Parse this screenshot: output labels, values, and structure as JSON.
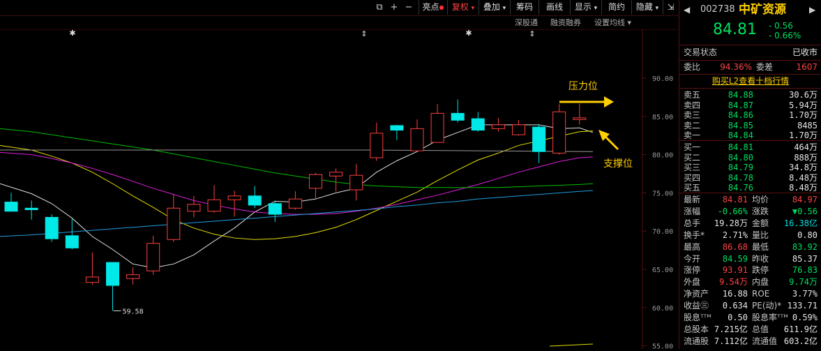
{
  "toolbar": {
    "buttons": [
      {
        "label": "亮点",
        "active": false
      },
      {
        "label": "复权",
        "active": true
      },
      {
        "label": "叠加",
        "active": false
      },
      {
        "label": "筹码",
        "active": false
      },
      {
        "label": "画线",
        "active": false
      },
      {
        "label": "显示",
        "active": false
      },
      {
        "label": "简约",
        "active": false
      },
      {
        "label": "隐藏",
        "active": false
      }
    ],
    "sub": [
      "深股通",
      "融资融券",
      "设置均线"
    ]
  },
  "chart_data": {
    "type": "candlestick",
    "y_ticks": [
      "90.00",
      "85.00",
      "80.00",
      "75.00",
      "70.00",
      "65.00",
      "60.00",
      "55.00"
    ],
    "ylim": [
      55,
      90
    ],
    "low_marker": "59.58",
    "annotations": [
      "压力位",
      "支撑位"
    ],
    "candles": [
      {
        "o": 73.8,
        "c": 72.6,
        "h": 75.0,
        "l": 72.6
      },
      {
        "o": 73.0,
        "c": 72.8,
        "h": 74.0,
        "l": 71.5
      },
      {
        "o": 71.8,
        "c": 69.0,
        "h": 72.2,
        "l": 68.6
      },
      {
        "o": 69.4,
        "c": 67.8,
        "h": 71.6,
        "l": 67.6
      },
      {
        "o": 63.3,
        "c": 64.0,
        "h": 67.2,
        "l": 63.0
      },
      {
        "o": 65.9,
        "c": 62.9,
        "h": 65.9,
        "l": 59.6
      },
      {
        "o": 63.8,
        "c": 64.3,
        "h": 65.3,
        "l": 63.0
      },
      {
        "o": 64.8,
        "c": 68.4,
        "h": 69.4,
        "l": 64.3
      },
      {
        "o": 68.9,
        "c": 73.0,
        "h": 74.8,
        "l": 68.6
      },
      {
        "o": 72.6,
        "c": 73.5,
        "h": 74.6,
        "l": 71.8
      },
      {
        "o": 72.6,
        "c": 74.1,
        "h": 76.0,
        "l": 72.4
      },
      {
        "o": 74.1,
        "c": 74.6,
        "h": 75.3,
        "l": 71.9
      },
      {
        "o": 74.6,
        "c": 73.4,
        "h": 75.9,
        "l": 73.0
      },
      {
        "o": 73.6,
        "c": 72.2,
        "h": 74.0,
        "l": 71.2
      },
      {
        "o": 73.0,
        "c": 74.2,
        "h": 75.2,
        "l": 72.8
      },
      {
        "o": 75.6,
        "c": 77.4,
        "h": 77.6,
        "l": 74.2
      },
      {
        "o": 77.2,
        "c": 77.7,
        "h": 78.2,
        "l": 75.2
      },
      {
        "o": 75.4,
        "c": 77.3,
        "h": 78.8,
        "l": 74.0
      },
      {
        "o": 79.6,
        "c": 82.8,
        "h": 84.2,
        "l": 79.2
      },
      {
        "o": 83.8,
        "c": 83.2,
        "h": 83.9,
        "l": 81.9
      },
      {
        "o": 80.5,
        "c": 83.4,
        "h": 84.6,
        "l": 80.4
      },
      {
        "o": 81.6,
        "c": 85.4,
        "h": 86.6,
        "l": 81.6
      },
      {
        "o": 85.4,
        "c": 84.5,
        "h": 87.2,
        "l": 84.2
      },
      {
        "o": 84.7,
        "c": 83.2,
        "h": 85.6,
        "l": 83.0
      },
      {
        "o": 83.4,
        "c": 83.9,
        "h": 84.8,
        "l": 83.0
      },
      {
        "o": 82.6,
        "c": 83.9,
        "h": 84.5,
        "l": 82.5
      },
      {
        "o": 83.6,
        "c": 80.4,
        "h": 84.0,
        "l": 78.9
      },
      {
        "o": 80.2,
        "c": 85.6,
        "h": 86.6,
        "l": 80.0
      },
      {
        "o": 84.59,
        "c": 84.81,
        "h": 86.68,
        "l": 83.92
      }
    ],
    "ma": {
      "white": [
        76.2,
        74.9,
        73.6,
        71.7,
        69.3,
        67.6,
        65.7,
        65.2,
        65.7,
        66.9,
        68.7,
        70.4,
        72.5,
        73.9,
        73.8,
        74.2,
        75.0,
        75.6,
        77.7,
        79.2,
        80.4,
        81.9,
        82.9,
        83.9,
        83.9,
        83.9,
        83.9,
        83.4,
        83.5
      ],
      "yellow": [
        81.2,
        80.6,
        79.8,
        78.9,
        77.7,
        76.2,
        74.6,
        73.1,
        71.5,
        70.4,
        69.6,
        69.1,
        68.9,
        69.0,
        69.3,
        69.8,
        70.5,
        71.5,
        72.7,
        73.9,
        75.1,
        76.6,
        78.0,
        79.3,
        80.2,
        81.2,
        81.8,
        82.4,
        83.0
      ],
      "magenta": [
        80.3,
        80.0,
        79.5,
        78.9,
        78.2,
        77.4,
        76.5,
        75.6,
        74.8,
        74.0,
        73.4,
        72.9,
        72.5,
        72.3,
        72.2,
        72.2,
        72.3,
        72.6,
        73.0,
        73.5,
        74.1,
        74.7,
        75.4,
        76.1,
        76.9,
        77.7,
        78.4,
        79.1,
        79.6
      ],
      "green": [
        83.4,
        83.0,
        82.6,
        82.2,
        81.8,
        81.4,
        81.0,
        80.6,
        80.1,
        79.6,
        79.1,
        78.6,
        78.1,
        77.6,
        77.2,
        76.8,
        76.4,
        76.1,
        75.9,
        75.8,
        75.7,
        75.7,
        75.7,
        75.7,
        75.7,
        75.8,
        75.9,
        76.0,
        76.1
      ],
      "cyan": [
        69.3,
        69.5,
        69.7,
        69.9,
        70.1,
        70.3,
        70.5,
        70.7,
        70.9,
        71.1,
        71.3,
        71.5,
        71.7,
        71.9,
        72.1,
        72.3,
        72.5,
        72.7,
        72.9,
        73.2,
        73.4,
        73.7,
        73.9,
        74.2,
        74.4,
        74.6,
        74.8,
        75.0,
        75.2
      ]
    }
  },
  "panel": {
    "code": "002738",
    "name": "中矿资源",
    "price": "84.81",
    "change": "- 0.56",
    "change_pct": "- 0.66%",
    "status_label": "交易状态",
    "status_value": "已收市",
    "weibi_label": "委比",
    "weibi_value": "94.36%",
    "weicha_label": "委差",
    "weicha_value": "1607",
    "l2_link": "购买L2查看十档行情",
    "asks": [
      {
        "label": "卖五",
        "price": "84.88",
        "vol": "30.6万"
      },
      {
        "label": "卖四",
        "price": "84.87",
        "vol": "5.94万"
      },
      {
        "label": "卖三",
        "price": "84.86",
        "vol": "1.70万"
      },
      {
        "label": "卖二",
        "price": "84.85",
        "vol": "8485"
      },
      {
        "label": "卖一",
        "price": "84.84",
        "vol": "1.70万"
      }
    ],
    "bids": [
      {
        "label": "买一",
        "price": "84.81",
        "vol": "464万"
      },
      {
        "label": "买二",
        "price": "84.80",
        "vol": "888万"
      },
      {
        "label": "买三",
        "price": "84.79",
        "vol": "34.8万"
      },
      {
        "label": "买四",
        "price": "84.78",
        "vol": "8.48万"
      },
      {
        "label": "买五",
        "price": "84.76",
        "vol": "8.48万"
      }
    ],
    "stats": [
      [
        "最新",
        "84.81",
        "red",
        "均价",
        "84.97",
        "red"
      ],
      [
        "涨幅",
        "-0.66%",
        "green",
        "涨跌",
        "▼0.56",
        "green"
      ],
      [
        "总手",
        "19.28万",
        "white",
        "金额",
        "16.38亿",
        "cyan"
      ],
      [
        "换手*",
        "2.71%",
        "white",
        "量比",
        "0.80",
        "white"
      ],
      [
        "最高",
        "86.68",
        "red",
        "最低",
        "83.92",
        "green"
      ],
      [
        "今开",
        "84.59",
        "green",
        "昨收",
        "85.37",
        "white"
      ],
      [
        "涨停",
        "93.91",
        "red",
        "跌停",
        "76.83",
        "green"
      ],
      [
        "外盘",
        "9.54万",
        "red",
        "内盘",
        "9.74万",
        "green"
      ],
      [
        "净资产",
        "16.88",
        "white",
        "ROE",
        "3.77%",
        "white"
      ],
      [
        "收益㊂",
        "0.634",
        "white",
        "PE(动)*",
        "133.71",
        "white"
      ],
      [
        "股息ᵀᵀᴹ",
        "0.50",
        "white",
        "股息率ᵀᵀᴹ",
        "0.59%",
        "white"
      ],
      [
        "总股本",
        "7.215亿",
        "white",
        "总值",
        "611.9亿",
        "white"
      ],
      [
        "流通股",
        "7.112亿",
        "white",
        "流通值",
        "603.2亿",
        "white"
      ]
    ]
  }
}
